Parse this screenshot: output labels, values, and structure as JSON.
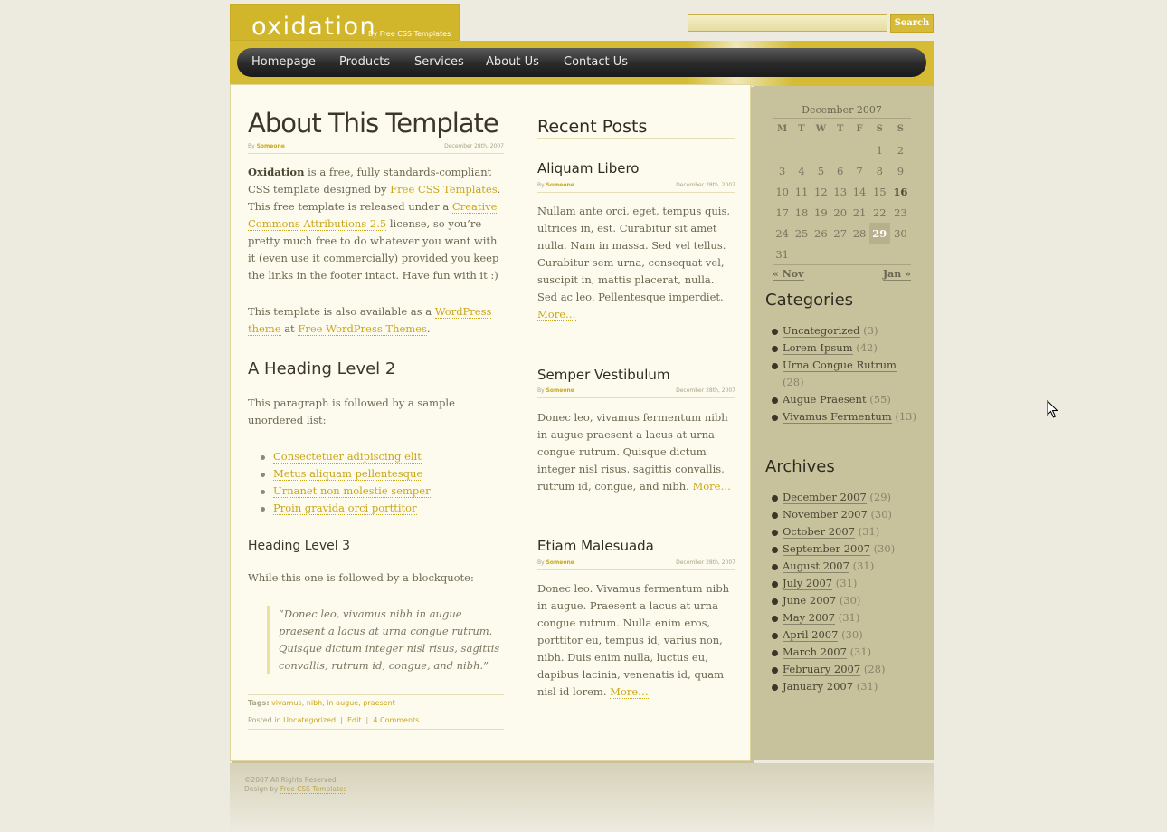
{
  "header": {
    "logo_title": "oxidation",
    "logo_subtitle": "By Free CSS Templates",
    "search_placeholder": "",
    "search_button": "Search"
  },
  "menu": [
    "Homepage",
    "Products",
    "Services",
    "About Us",
    "Contact Us"
  ],
  "main": {
    "title": "About This Template",
    "by_label": "By",
    "author": "Someone",
    "date": "December 28th, 2007",
    "intro": {
      "bold": "Oxidation",
      "text1": " is a free, fully standards-compliant CSS template designed by ",
      "link1": "Free CSS Templates",
      "text2": ". This free template is released under a ",
      "link2": "Creative Commons Attributions 2.5",
      "text3": " license, so you’re pretty much free to do whatever you want with it (even use it commercially) provided you keep the links in the footer intact. Have fun with it :)"
    },
    "para2": {
      "text1": "This template is also available as a ",
      "link1": "WordPress theme",
      "text2": " at ",
      "link2": "Free WordPress Themes",
      "text3": "."
    },
    "h2": "A Heading Level 2",
    "h2_para": "This paragraph is followed by a sample unordered list:",
    "list": [
      "Consectetuer adipiscing elit",
      "Metus aliquam pellentesque",
      "Urnanet non molestie semper",
      "Proin gravida orci porttitor"
    ],
    "h3": "Heading Level 3",
    "h3_para": "While this one is followed by a blockquote:",
    "quote": "“Donec leo, vivamus nibh in augue praesent a lacus at urna congue rutrum. Quisque dictum integer nisl risus, sagittis convallis, rutrum id, congue, and nibh.”",
    "tags_label": "Tags:",
    "tags": [
      "vivamus",
      "nibh",
      "in augue",
      "praesent"
    ],
    "posted_in_label": "Posted in",
    "category": "Uncategorized",
    "edit": "Edit",
    "comments": "4 Comments"
  },
  "recent": {
    "heading": "Recent Posts",
    "posts": [
      {
        "title": "Aliquam Libero",
        "by": "By",
        "author": "Someone",
        "date": "December 28th, 2007",
        "body": "Nullam ante orci, eget, tempus quis, ultrices in, est. Curabitur sit amet nulla. Nam in massa. Sed vel tellus. Curabitur sem urna, consequat vel, suscipit in, mattis placerat, nulla. Sed ac leo. Pellentesque imperdiet. ",
        "more": "More…"
      },
      {
        "title": "Semper Vestibulum",
        "by": "By",
        "author": "Someone",
        "date": "December 28th, 2007",
        "body": "Donec leo, vivamus fermentum nibh in augue praesent a lacus at urna congue rutrum. Quisque dictum integer nisl risus, sagittis convallis, rutrum id, congue, and nibh. ",
        "more": "More…"
      },
      {
        "title": "Etiam Malesuada",
        "by": "By",
        "author": "Someone",
        "date": "December 28th, 2007",
        "body": "Donec leo. Vivamus fermentum nibh in augue. Praesent a lacus at urna congue rutrum. Nulla enim eros, porttitor eu, tempus id, varius non, nibh. Duis enim nulla, luctus eu, dapibus lacinia, venenatis id, quam nisl id lorem. ",
        "more": "More…"
      }
    ]
  },
  "calendar": {
    "caption": "December 2007",
    "weekdays": [
      "M",
      "T",
      "W",
      "T",
      "F",
      "S",
      "S"
    ],
    "weeks": [
      [
        "",
        "",
        "",
        "",
        "",
        "1",
        "2"
      ],
      [
        "3",
        "4",
        "5",
        "6",
        "7",
        "8",
        "9"
      ],
      [
        "10",
        "11",
        "12",
        "13",
        "14",
        "15",
        "16"
      ],
      [
        "17",
        "18",
        "19",
        "20",
        "21",
        "22",
        "23"
      ],
      [
        "24",
        "25",
        "26",
        "27",
        "28",
        "29",
        "30"
      ],
      [
        "31",
        "",
        "",
        "",
        "",
        "",
        ""
      ]
    ],
    "today": "29",
    "bold_day": "16",
    "prev": "« Nov",
    "next": "Jan »"
  },
  "categories": {
    "heading": "Categories",
    "items": [
      {
        "name": "Uncategorized",
        "count": "(3)"
      },
      {
        "name": "Lorem Ipsum",
        "count": "(42)"
      },
      {
        "name": "Urna Congue Rutrum",
        "count": "(28)"
      },
      {
        "name": "Augue Praesent",
        "count": "(55)"
      },
      {
        "name": "Vivamus Fermentum",
        "count": "(13)"
      }
    ]
  },
  "archives": {
    "heading": "Archives",
    "items": [
      {
        "name": "December 2007",
        "count": "(29)"
      },
      {
        "name": "November 2007",
        "count": "(30)"
      },
      {
        "name": "October 2007",
        "count": "(31)"
      },
      {
        "name": "September 2007",
        "count": "(30)"
      },
      {
        "name": "August 2007",
        "count": "(31)"
      },
      {
        "name": "July 2007",
        "count": "(31)"
      },
      {
        "name": "June 2007",
        "count": "(30)"
      },
      {
        "name": "May 2007",
        "count": "(31)"
      },
      {
        "name": "April 2007",
        "count": "(30)"
      },
      {
        "name": "March 2007",
        "count": "(31)"
      },
      {
        "name": "February 2007",
        "count": "(28)"
      },
      {
        "name": "January 2007",
        "count": "(31)"
      }
    ]
  },
  "footer": {
    "copyright": "©2007 All Rights Reserved.",
    "design_by": "Design by ",
    "design_link": "Free CSS Templates"
  },
  "colors": {
    "accent": "#d1b52a",
    "link": "#c9a61a",
    "content_bg": "#fdfbee",
    "sidebar_bg": "#c7c19c",
    "menu_bg": "#2a2a2a"
  }
}
